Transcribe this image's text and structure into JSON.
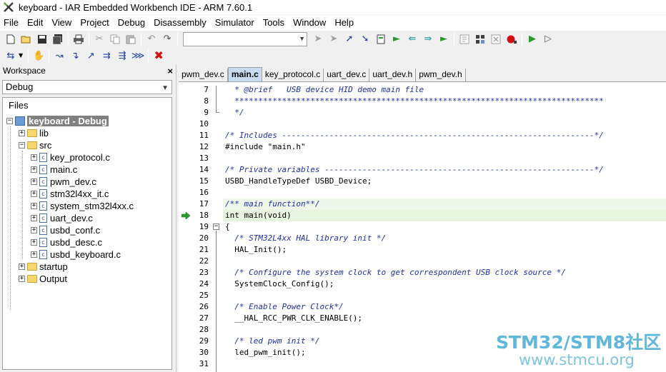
{
  "window": {
    "title": "keyboard - IAR Embedded Workbench IDE - ARM 7.60.1",
    "icon": "iar-app-icon"
  },
  "menu": [
    "File",
    "Edit",
    "View",
    "Project",
    "Debug",
    "Disassembly",
    "Simulator",
    "Tools",
    "Window",
    "Help"
  ],
  "toolbar": {
    "search_value": ""
  },
  "workspace": {
    "header": "Workspace",
    "close_glyph": "×",
    "config": "Debug",
    "files_header": "Files",
    "project": "keyboard - Debug",
    "tree": {
      "lib": "lib",
      "src": "src",
      "src_files": [
        "key_protocol.c",
        "main.c",
        "pwm_dev.c",
        "stm32l4xx_it.c",
        "system_stm32l4xx.c",
        "uart_dev.c",
        "usbd_conf.c",
        "usbd_desc.c",
        "usbd_keyboard.c"
      ],
      "startup": "startup",
      "output": "Output"
    }
  },
  "tabs": [
    "pwm_dev.c",
    "main.c",
    "key_protocol.c",
    "uart_dev.c",
    "uart_dev.h",
    "pwm_dev.h"
  ],
  "active_tab": "main.c",
  "editor": {
    "lines": [
      {
        "n": "7",
        "text": "  * @brief   USB device HID demo main file",
        "type": "comment"
      },
      {
        "n": "8",
        "text": "  ******************************************************************************",
        "type": "comment"
      },
      {
        "n": "9",
        "text": "  */",
        "type": "comment"
      },
      {
        "n": "10",
        "text": "",
        "type": "code"
      },
      {
        "n": "11",
        "text": "/* Includes ------------------------------------------------------------------*/",
        "type": "comment"
      },
      {
        "n": "12",
        "text": "#include \"main.h\"",
        "type": "code"
      },
      {
        "n": "13",
        "text": "",
        "type": "code"
      },
      {
        "n": "14",
        "text": "/* Private variables ---------------------------------------------------------*/",
        "type": "comment"
      },
      {
        "n": "15",
        "text": "USBD_HandleTypeDef USBD_Device;",
        "type": "code"
      },
      {
        "n": "16",
        "text": "",
        "type": "code"
      },
      {
        "n": "17",
        "text": "/** main function**/",
        "type": "comment"
      },
      {
        "n": "18",
        "text": "int main(void)",
        "type": "code"
      },
      {
        "n": "19",
        "text": "{",
        "type": "code"
      },
      {
        "n": "20",
        "text": "  /* STM32L4xx HAL library init */",
        "type": "comment"
      },
      {
        "n": "21",
        "text": "  HAL_Init();",
        "type": "code"
      },
      {
        "n": "22",
        "text": "",
        "type": "code"
      },
      {
        "n": "23",
        "text": "  /* Configure the system clock to get correspondent USB clock source */",
        "type": "comment"
      },
      {
        "n": "24",
        "text": "  SystemClock_Config();",
        "type": "code"
      },
      {
        "n": "25",
        "text": "",
        "type": "code"
      },
      {
        "n": "26",
        "text": "  /* Enable Power Clock*/",
        "type": "comment"
      },
      {
        "n": "27",
        "text": "  __HAL_RCC_PWR_CLK_ENABLE();",
        "type": "code"
      },
      {
        "n": "28",
        "text": "",
        "type": "code"
      },
      {
        "n": "29",
        "text": "  /* led pwm init */",
        "type": "comment"
      },
      {
        "n": "30",
        "text": "  led_pwm_init();",
        "type": "code"
      },
      {
        "n": "31",
        "text": "",
        "type": "code"
      }
    ],
    "current_line": "18",
    "comment_color": "#1e2fa8",
    "highlight_color": "#e6f4e0"
  },
  "watermark": {
    "main": "STM32/STM8社区",
    "sub": "www.stmcu.org"
  }
}
